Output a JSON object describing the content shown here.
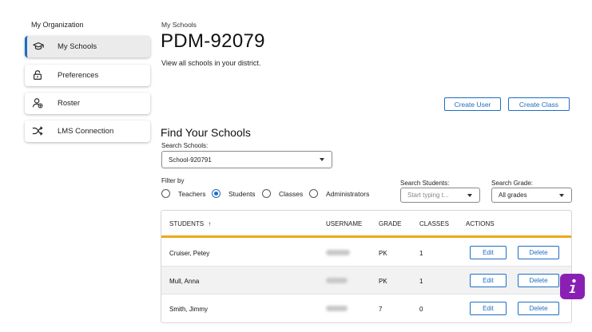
{
  "sidebar": {
    "heading": "My Organization",
    "items": [
      {
        "label": "My Schools",
        "icon": "graduation-cap-icon"
      },
      {
        "label": "Preferences",
        "icon": "lock-icon"
      },
      {
        "label": "Roster",
        "icon": "user-plus-icon"
      },
      {
        "label": "LMS Connection",
        "icon": "shuffle-icon"
      }
    ]
  },
  "header": {
    "breadcrumb": "My Schools",
    "title": "PDM-92079",
    "subtitle": "View all schools in your district."
  },
  "actions": {
    "create_user": "Create User",
    "create_class": "Create Class"
  },
  "find": {
    "title": "Find Your Schools",
    "search_schools_label": "Search Schools:",
    "search_schools_value": "School-920791",
    "filter_label": "Filter by",
    "filters": [
      "Teachers",
      "Students",
      "Classes",
      "Administrators"
    ],
    "selected_filter": "Students",
    "search_students_label": "Search Students:",
    "search_students_placeholder": "Start typing t...",
    "search_grade_label": "Search Grade:",
    "search_grade_value": "All grades"
  },
  "table": {
    "headers": {
      "students": "STUDENTS",
      "sort_arrow": "↑",
      "username": "USERNAME",
      "grade": "GRADE",
      "classes": "CLASSES",
      "actions": "ACTIONS"
    },
    "rows": [
      {
        "name": "Cruiser, Petey",
        "grade": "PK",
        "classes": "1",
        "edit": "Edit",
        "delete": "Delete"
      },
      {
        "name": "Mull, Anna",
        "grade": "PK",
        "classes": "1",
        "edit": "Edit",
        "delete": "Delete"
      },
      {
        "name": "Smith, Jimmy",
        "grade": "7",
        "classes": "0",
        "edit": "Edit",
        "delete": "Delete"
      }
    ]
  },
  "info_button": {
    "icon": "info-icon",
    "label": "i"
  },
  "colors": {
    "accent": "#1f6dc4",
    "header_rule": "#f0a81a",
    "info_fab": "#8a1fb3"
  }
}
